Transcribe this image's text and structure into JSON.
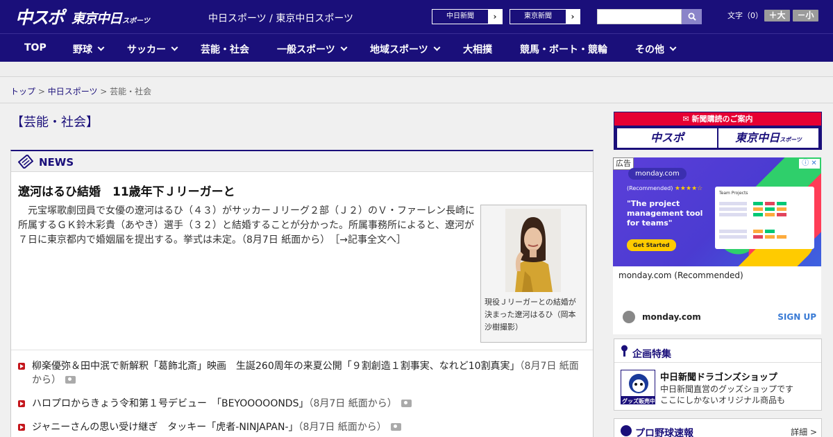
{
  "header": {
    "logo_main": "中スポ",
    "logo_tokyo": "東京中日",
    "logo_sports": "スポーツ",
    "site_title": "中日スポーツ / 東京中日スポーツ",
    "ext_links": [
      {
        "label": "中日新聞",
        "arrow": "›"
      },
      {
        "label": "東京新聞",
        "arrow": "›"
      }
    ],
    "search_placeholder": "",
    "font_size_label": "文字（0）",
    "font_larger": "＋大",
    "font_smaller": "－小"
  },
  "nav": [
    {
      "label": "TOP",
      "dropdown": false
    },
    {
      "label": "野球",
      "dropdown": true
    },
    {
      "label": "サッカー",
      "dropdown": true
    },
    {
      "label": "芸能・社会",
      "dropdown": false
    },
    {
      "label": "一般スポーツ",
      "dropdown": true
    },
    {
      "label": "地域スポーツ",
      "dropdown": true
    },
    {
      "label": "大相撲",
      "dropdown": false
    },
    {
      "label": "競馬・ボート・競輪",
      "dropdown": false
    },
    {
      "label": "その他",
      "dropdown": true
    }
  ],
  "breadcrumb": {
    "top": "トップ",
    "sep": " > ",
    "parent": "中日スポーツ",
    "current": "芸能・社会"
  },
  "page_heading": "【芸能・社会】",
  "news": {
    "section_title": "NEWS",
    "headline": "遼河はるひ結婚　11歳年下Ｊリーガーと",
    "lead": "元宝塚歌劇団員で女優の遼河はるひ（４３）がサッカーＪリーグ２部（Ｊ２）のＶ・ファーレン長崎に所属するＧＫ鈴木彩貴（あやき）選手（３２）と結婚することが分かった。所属事務所によると、遼河が７日に東京都内で婚姻届を提出する。挙式は未定。（8月7日 紙面から）",
    "more": "［→記事全文へ］",
    "caption": "現役Ｊリーガーとの結婚が決まった遼河はるひ（岡本沙樹撮影）",
    "items": [
      {
        "title": "柳楽優弥＆田中泯で新解釈「葛飾北斎」映画　生誕260周年の来夏公開「９割創造１割事実、なれど10割真実」",
        "date": "（8月7日 紙面から）"
      },
      {
        "title": "ハロプロからきょう令和第１号デビュー　「BEYOOOOONDS」",
        "date": "（8月7日 紙面から）"
      },
      {
        "title": "ジャニーさんの思い受け継ぎ　タッキー「虎者-NINJAPAN-」",
        "date": "（8月7日 紙面から）"
      }
    ]
  },
  "subscription": {
    "title": "新聞購読のご案内",
    "buttons": [
      "中スポ",
      "東京中日"
    ],
    "button_suffix": "スポーツ"
  },
  "ad": {
    "badge": "広告",
    "close": "ⓘ ✕",
    "logo": "monday.com",
    "recommended": "(Recommended)",
    "stars": "★★★★☆",
    "headline": "\"The project management tool for teams\"",
    "cta": "Get Started",
    "screen_title": "Team Projects",
    "advertiser": "monday.com (Recommended)",
    "domain": "monday.com",
    "signup": "SIGN UP"
  },
  "feature": {
    "title": "企画特集",
    "item_title": "中日新聞ドラゴンズショップ",
    "item_desc_1": "中日新聞直営のグッズショップです",
    "item_desc_2": "ここにしかないオリジナル商品も",
    "thumb_text": "グッズ販売中"
  },
  "baseball": {
    "title": "プロ野球速報",
    "more": "詳細 >"
  },
  "colors": {
    "brand": "#1a0f7a",
    "accent_red": "#e60033",
    "bullet": "#c4161c"
  }
}
